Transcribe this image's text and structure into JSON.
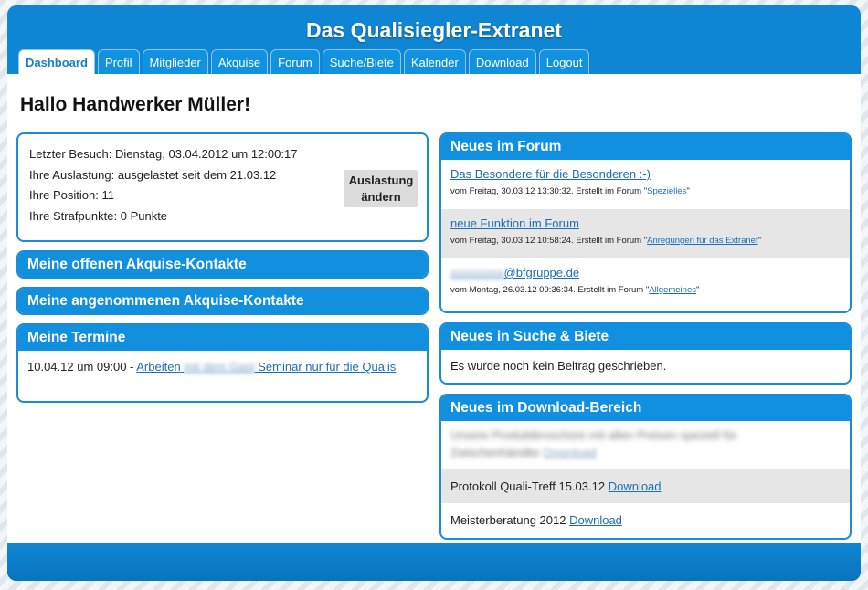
{
  "site": {
    "title": "Das Qualisiegler-Extranet"
  },
  "tabs": [
    {
      "label": "Dashboard",
      "active": true
    },
    {
      "label": "Profil"
    },
    {
      "label": "Mitglieder"
    },
    {
      "label": "Akquise"
    },
    {
      "label": "Forum"
    },
    {
      "label": "Suche/Biete"
    },
    {
      "label": "Kalender"
    },
    {
      "label": "Download"
    },
    {
      "label": "Logout"
    }
  ],
  "greeting": "Hallo Handwerker Müller!",
  "status": {
    "last_visit": "Letzter Besuch: Dienstag, 03.04.2012 um 12:00:17",
    "utilization": "Ihre Auslastung: ausgelastet seit dem 21.03.12",
    "position": "Ihre Position: 11",
    "penalty": "Ihre Strafpunkte: 0 Punkte",
    "button_line1": "Auslastung",
    "button_line2": "ändern"
  },
  "open_contacts": {
    "title": "Meine offenen Akquise-Kontakte"
  },
  "accepted_contacts": {
    "title": "Meine angenommenen Akquise-Kontakte"
  },
  "appointments": {
    "title": "Meine Termine",
    "entry_prefix": "10.04.12 um 09:00 - ",
    "entry_link_start": "Arbeiten",
    "entry_link_blurred": "mit dem Gast",
    "entry_link_end": "Seminar nur für die Qualis"
  },
  "forum": {
    "title": "Neues im Forum",
    "items": [
      {
        "title": "Das Besondere für die Besonderen :-)",
        "meta": "vom Freitag, 30.03.12 13:30:32. Erstellt im Forum \"",
        "forum": "Spezielles",
        "meta_end": "\""
      },
      {
        "title": "neue Funktion im Forum",
        "meta": "vom Freitag, 30.03.12 10:58:24. Erstellt im Forum \"",
        "forum": "Anregungen für das Extranet",
        "meta_end": "\""
      },
      {
        "title_blurred": "xxxxxxxxx",
        "title": "@bfgruppe.de",
        "meta": "vom Montag, 26.03.12 09:36:34. Erstellt im Forum \"",
        "forum": "Allgemeines",
        "meta_end": "\""
      }
    ]
  },
  "search_offer": {
    "title": "Neues in Suche & Biete",
    "empty_text": "Es wurde noch kein Beitrag geschrieben."
  },
  "downloads": {
    "title": "Neues im Download-Bereich",
    "blurred_line1": "Unsere Produktbroschüre mit allen Preisen speziell für",
    "blurred_line2": "Zwischenhändler",
    "blurred_link": "Download",
    "items": [
      {
        "text": "Protokoll Quali-Treff 15.03.12 ",
        "link": "Download"
      },
      {
        "text": "Meisterberatung 2012 ",
        "link": "Download"
      }
    ]
  }
}
